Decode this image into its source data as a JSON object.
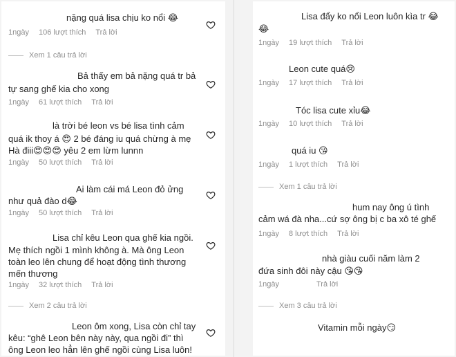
{
  "left": {
    "comments": [
      {
        "text": [
          "nặng quá lisa chịu ko nổi 😂"
        ],
        "time": "1ngày",
        "likes": "106 lượt thích",
        "reply": "Trả lời"
      },
      {
        "text": [
          "Bả thấy em bả nặng quá tr bả",
          "tự sang ghế kia cho xong"
        ],
        "time": "1ngày",
        "likes": "61 lượt thích",
        "reply": "Trả lời"
      },
      {
        "text": [
          "là trời bé leon vs bé lisa tình cảm",
          "quá ik thoy á 😍 2 bé đáng iu quá chừng à mẹ",
          "Hà điii😍😍😍 yêu 2 em lừm lunnn"
        ],
        "time": "1ngày",
        "likes": "50 lượt thích",
        "reply": "Trả lời"
      },
      {
        "text": [
          "Ai làm cái má Leon đỏ ửng",
          "như quả đào d😂"
        ],
        "time": "1ngày",
        "likes": "50 lượt thích",
        "reply": "Trả lời"
      },
      {
        "text": [
          "Lisa chỉ kêu Leon qua ghế kia ngồi.",
          "Mẹ thích ngồi 1 mình không à. Mà ông Leon",
          "toàn leo lên chung để hoạt động tình thương",
          "mến thương"
        ],
        "time": "1ngày",
        "likes": "32 lượt thích",
        "reply": "Trả lời"
      },
      {
        "text": [
          "Leon ôm xong, Lisa còn chỉ tay",
          "kêu: “ghê Leon bên này này, qua ngồi đi” thì",
          "ông Leon leo hẳn lên ghế ngồi cùng Lisa luôn!"
        ]
      }
    ],
    "view_replies": [
      "Xem 1 câu trả lời",
      "Xem 2 câu trả lời"
    ]
  },
  "right": {
    "comments": [
      {
        "text": [
          "Lisa đẩy ko nổi Leon luôn kìa tr 😂",
          "😂"
        ],
        "time": "1ngày",
        "likes": "19 lượt thích",
        "reply": "Trả lời"
      },
      {
        "text": [
          "Leon cute quá😢"
        ],
        "time": "1ngày",
        "likes": "17 lượt thích",
        "reply": "Trả lời"
      },
      {
        "text": [
          "Tóc lisa cute xỉu😂"
        ],
        "time": "1ngày",
        "likes": "10 lượt thích",
        "reply": "Trả lời"
      },
      {
        "text": [
          "quá iu 😘"
        ],
        "time": "1ngày",
        "likes": "1 lượt thích",
        "reply": "Trả lời"
      },
      {
        "text": [
          "hum nay ông ú tình",
          "cảm wá đà nha...cứ sợ ông bị c ba xô té ghế"
        ],
        "time": "1ngày",
        "likes": "8 lượt thích",
        "reply": "Trả lời"
      },
      {
        "text": [
          "nhà giàu cuối năm làm 2",
          "đứa sinh đôi này cậu 😘😘"
        ],
        "time": "1ngày",
        "likes": "",
        "reply": "Trả lời"
      },
      {
        "text": [
          "Vitamin mỗi ngày😏"
        ]
      }
    ],
    "view_replies": [
      "Xem 1 câu trả lời",
      "Xem 3 câu trả lời"
    ]
  }
}
